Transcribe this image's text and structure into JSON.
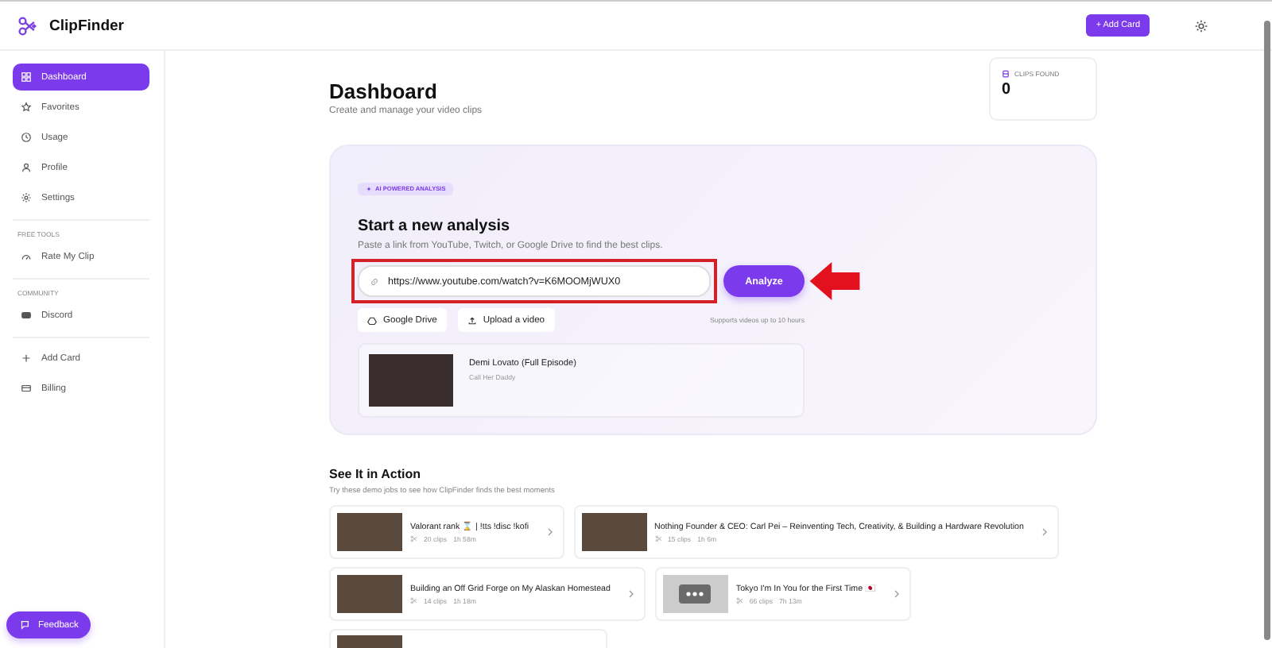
{
  "app": {
    "name": "ClipFinder"
  },
  "header": {
    "add_card": "+ Add Card"
  },
  "sidebar": {
    "items": [
      {
        "label": "Dashboard",
        "selected": true
      },
      {
        "label": "Favorites",
        "selected": false
      },
      {
        "label": "Usage",
        "selected": false
      },
      {
        "label": "Profile",
        "selected": false
      },
      {
        "label": "Settings",
        "selected": false
      }
    ],
    "sections": [
      {
        "title": "FREE TOOLS",
        "items": [
          {
            "label": "Rate My Clip",
            "selected": false
          }
        ]
      },
      {
        "title": "COMMUNITY",
        "items": [
          {
            "label": "Discord",
            "selected": false
          }
        ]
      },
      {
        "items": [
          {
            "label": "Add Card",
            "selected": false
          },
          {
            "label": "Billing",
            "selected": false
          }
        ]
      }
    ],
    "feedback": "Feedback"
  },
  "page": {
    "title": "Dashboard",
    "subtitle": "Create and manage your video clips"
  },
  "stat": {
    "label": "CLIPS FOUND",
    "value": "0"
  },
  "analysis": {
    "badge": "AI POWERED ANALYSIS",
    "title": "Start a new analysis",
    "subtitle": "Paste a link from YouTube, Twitch, or Google Drive to find the best clips.",
    "url": "https://www.youtube.com/watch?v=K6MOOMjWUX0",
    "analyze": "Analyze",
    "sources": [
      "Google Drive",
      "Upload a video"
    ],
    "note": "Supports videos up to 10 hours",
    "recent": {
      "title": "Demi Lovato (Full Episode)",
      "channel": "Call Her Daddy"
    }
  },
  "demos": {
    "title": "See It in Action",
    "subtitle": "Try these demo jobs to see how ClipFinder finds the best moments",
    "items": [
      {
        "kind": "video",
        "title": "Valorant rank ⌛ | !tts !disc !kofi",
        "clips": "20 clips",
        "duration": "1h 58m"
      },
      {
        "kind": "video",
        "title": "Nothing Founder & CEO: Carl Pei – Reinventing Tech, Creativity, & Building a Hardware Revolution",
        "clips": "15 clips",
        "duration": "1h 6m"
      },
      {
        "kind": "video",
        "title": "Building an Off Grid Forge on My Alaskan Homestead",
        "clips": "14 clips",
        "duration": "1h 18m"
      },
      {
        "kind": "placeholder",
        "title": "Tokyo I'm In You for the First Time 🇯🇵",
        "clips": "66 clips",
        "duration": "7h 13m"
      },
      {
        "kind": "video"
      }
    ]
  }
}
